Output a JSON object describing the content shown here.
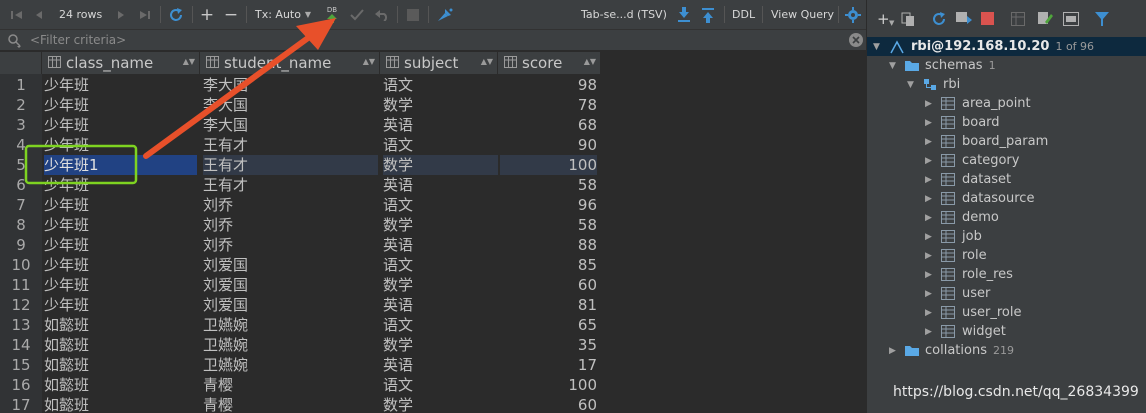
{
  "toolbar": {
    "rows_label": "24 rows",
    "tx_label": "Tx: Auto",
    "submit_label": "DB",
    "export_format": "Tab-se...d (TSV)",
    "ddl_label": "DDL",
    "view_query_label": "View Query"
  },
  "filter": {
    "placeholder": "<Filter criteria>"
  },
  "table": {
    "columns": [
      "class_name",
      "student_name",
      "subject",
      "score"
    ],
    "rows": [
      {
        "n": "1",
        "class_name": "少年班",
        "student_name": "李大国",
        "subject": "语文",
        "score": "98"
      },
      {
        "n": "2",
        "class_name": "少年班",
        "student_name": "李大国",
        "subject": "数学",
        "score": "78"
      },
      {
        "n": "3",
        "class_name": "少年班",
        "student_name": "李大国",
        "subject": "英语",
        "score": "68"
      },
      {
        "n": "4",
        "class_name": "少年班",
        "student_name": "王有才",
        "subject": "语文",
        "score": "90"
      },
      {
        "n": "5",
        "class_name": "少年班1",
        "student_name": "王有才",
        "subject": "数学",
        "score": "100"
      },
      {
        "n": "6",
        "class_name": "少年班",
        "student_name": "王有才",
        "subject": "英语",
        "score": "58"
      },
      {
        "n": "7",
        "class_name": "少年班",
        "student_name": "刘乔",
        "subject": "语文",
        "score": "96"
      },
      {
        "n": "8",
        "class_name": "少年班",
        "student_name": "刘乔",
        "subject": "数学",
        "score": "58"
      },
      {
        "n": "9",
        "class_name": "少年班",
        "student_name": "刘乔",
        "subject": "英语",
        "score": "88"
      },
      {
        "n": "10",
        "class_name": "少年班",
        "student_name": "刘爱国",
        "subject": "语文",
        "score": "85"
      },
      {
        "n": "11",
        "class_name": "少年班",
        "student_name": "刘爱国",
        "subject": "数学",
        "score": "60"
      },
      {
        "n": "12",
        "class_name": "少年班",
        "student_name": "刘爱国",
        "subject": "英语",
        "score": "81"
      },
      {
        "n": "13",
        "class_name": "如懿班",
        "student_name": "卫嬿婉",
        "subject": "语文",
        "score": "65"
      },
      {
        "n": "14",
        "class_name": "如懿班",
        "student_name": "卫嬿婉",
        "subject": "数学",
        "score": "35"
      },
      {
        "n": "15",
        "class_name": "如懿班",
        "student_name": "卫嬿婉",
        "subject": "英语",
        "score": "17"
      },
      {
        "n": "16",
        "class_name": "如懿班",
        "student_name": "青樱",
        "subject": "语文",
        "score": "100"
      },
      {
        "n": "17",
        "class_name": "如懿班",
        "student_name": "青樱",
        "subject": "数学",
        "score": "60"
      }
    ],
    "selected_row": 5
  },
  "tree": {
    "connection": "rbi@192.168.10.20",
    "connection_count": "1 of 96",
    "schemas_label": "schemas",
    "schemas_count": "1",
    "schema_name": "rbi",
    "tables": [
      "area_point",
      "board",
      "board_param",
      "category",
      "dataset",
      "datasource",
      "demo",
      "job",
      "role",
      "role_res",
      "user",
      "user_role",
      "widget"
    ],
    "collations_label": "collations",
    "collations_count": "219"
  },
  "watermark": "https://blog.csdn.net/qq_26834399",
  "colors": {
    "background": "#2b2b2b",
    "toolbar": "#3c3f41",
    "selection": "#0d293e",
    "row_selection": "#214283",
    "highlight_box": "#7ed321",
    "arrow": "#e8502a",
    "accent_blue": "#3d8fd1"
  }
}
